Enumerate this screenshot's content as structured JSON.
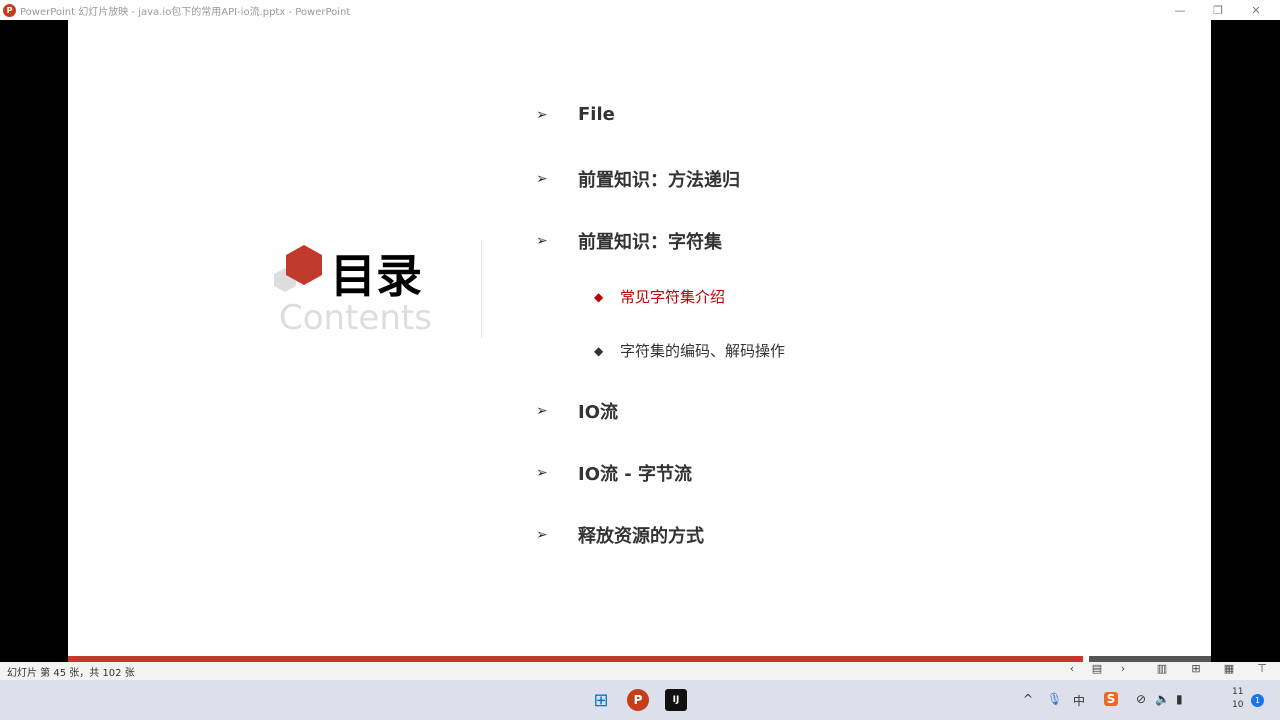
{
  "window": {
    "title": "PowerPoint 幻灯片放映 - java.io包下的常用API-io流.pptx - PowerPoint",
    "app_icon": "P"
  },
  "slide": {
    "title": "目录",
    "subtitle": "Contents",
    "items": [
      {
        "label": "File"
      },
      {
        "label": "前置知识：方法递归"
      },
      {
        "label": "前置知识：字符集"
      },
      {
        "label": "IO流"
      },
      {
        "label": "IO流 - 字节流"
      },
      {
        "label": "释放资源的方式"
      }
    ],
    "subitems": [
      {
        "label": "常见字符集介绍",
        "active": true
      },
      {
        "label": "字符集的编码、解码操作",
        "active": false
      }
    ],
    "accent": "#c0392b"
  },
  "status": {
    "slide_info": "幻灯片 第 45 张，共 102 张"
  },
  "clock": {
    "line1": "11",
    "line2": "10"
  },
  "notifications": "1",
  "tray": {
    "ime": "中"
  }
}
